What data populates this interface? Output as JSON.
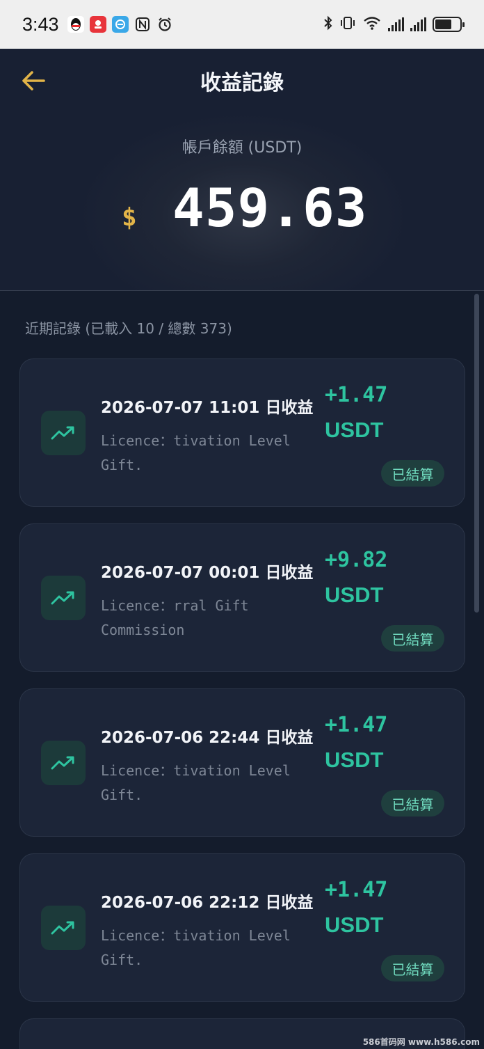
{
  "status_bar": {
    "time": "3:43",
    "notif_icons": [
      "qq-icon",
      "red-app-icon",
      "blue-app-icon",
      "nfc-icon",
      "alarm-icon"
    ],
    "right_icons": [
      "bluetooth-icon",
      "vibrate-icon",
      "wifi-icon",
      "signal-icon",
      "signal-icon",
      "battery-icon"
    ]
  },
  "header": {
    "title": "收益記錄",
    "balance_label": "帳戶餘額 (USDT)",
    "currency_symbol": "$",
    "balance": "459.63"
  },
  "colors": {
    "accent_gold": "#e2b448",
    "positive_green": "#2ec4a0",
    "background": "#141c2c",
    "card": "#1c2538"
  },
  "records": {
    "label": "近期記錄 (已載入 10 / 總數 373)",
    "items": [
      {
        "title": "2026-07-07 11:01 日收益",
        "desc_line1": "Licence：tivation Level",
        "desc_line2": "Gift.",
        "amount": "+1.47",
        "unit": "USDT",
        "status": "已結算"
      },
      {
        "title": "2026-07-07 00:01 日收益",
        "desc_line1": "Licence：rral Gift",
        "desc_line2": "Commission",
        "amount": "+9.82",
        "unit": "USDT",
        "status": "已結算"
      },
      {
        "title": "2026-07-06 22:44 日收益",
        "desc_line1": "Licence：tivation Level",
        "desc_line2": "Gift.",
        "amount": "+1.47",
        "unit": "USDT",
        "status": "已結算"
      },
      {
        "title": "2026-07-06 22:12 日收益",
        "desc_line1": "Licence：tivation Level",
        "desc_line2": "Gift.",
        "amount": "+1.47",
        "unit": "USDT",
        "status": "已結算"
      }
    ]
  },
  "watermark": "586首码网 www.h586.com"
}
